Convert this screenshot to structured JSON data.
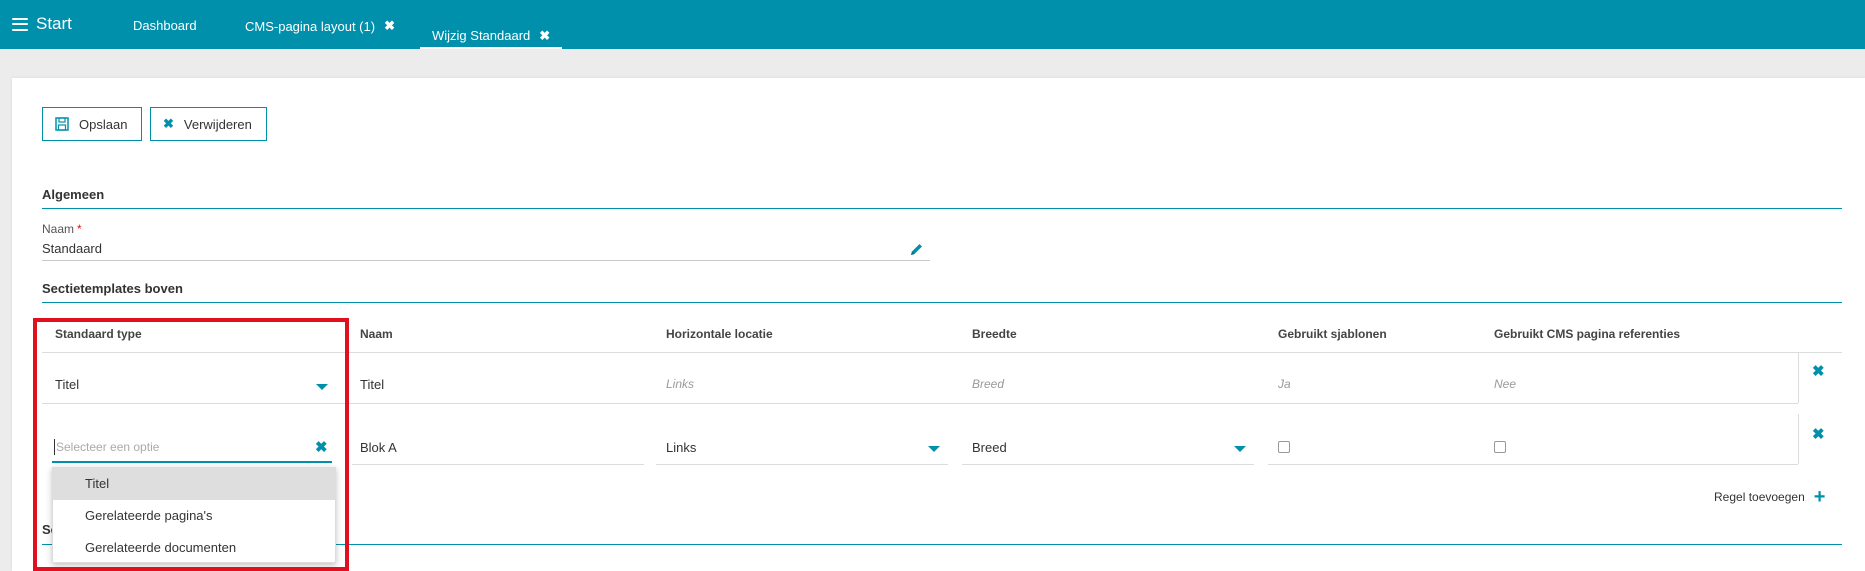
{
  "topbar": {
    "start_label": "Start",
    "tabs": [
      {
        "label": "Dashboard",
        "closable": false
      },
      {
        "label": "CMS-pagina layout (1)",
        "closable": true
      },
      {
        "label": "Wijzig Standaard",
        "closable": true,
        "active": true
      }
    ],
    "close_glyph": "✖"
  },
  "toolbar": {
    "save_label": "Opslaan",
    "delete_label": "Verwijderen"
  },
  "general": {
    "title": "Algemeen",
    "name_label": "Naam",
    "required_marker": "*",
    "name_value": "Standaard"
  },
  "top_templates": {
    "title": "Sectietemplates boven",
    "columns": [
      "Standaard type",
      "Naam",
      "Horizontale locatie",
      "Breedte",
      "Gebruikt sjablonen",
      "Gebruikt CMS pagina referenties"
    ],
    "row1": {
      "type": "Titel",
      "name": "Titel",
      "location": "Links",
      "width": "Breed",
      "uses_templates": "Ja",
      "uses_refs": "Nee"
    },
    "row2": {
      "type_placeholder": "Selecteer een optie",
      "name": "Blok A",
      "location": "Links",
      "width": "Breed"
    },
    "dropdown_options": [
      "Titel",
      "Gerelateerde pagina's",
      "Gerelateerde documenten"
    ],
    "add_row_label": "Regel toevoegen"
  },
  "next_section_title": "Se",
  "colors": {
    "accent": "#0090ab",
    "highlight_box": "#e0101f",
    "required": "#e0101f"
  }
}
